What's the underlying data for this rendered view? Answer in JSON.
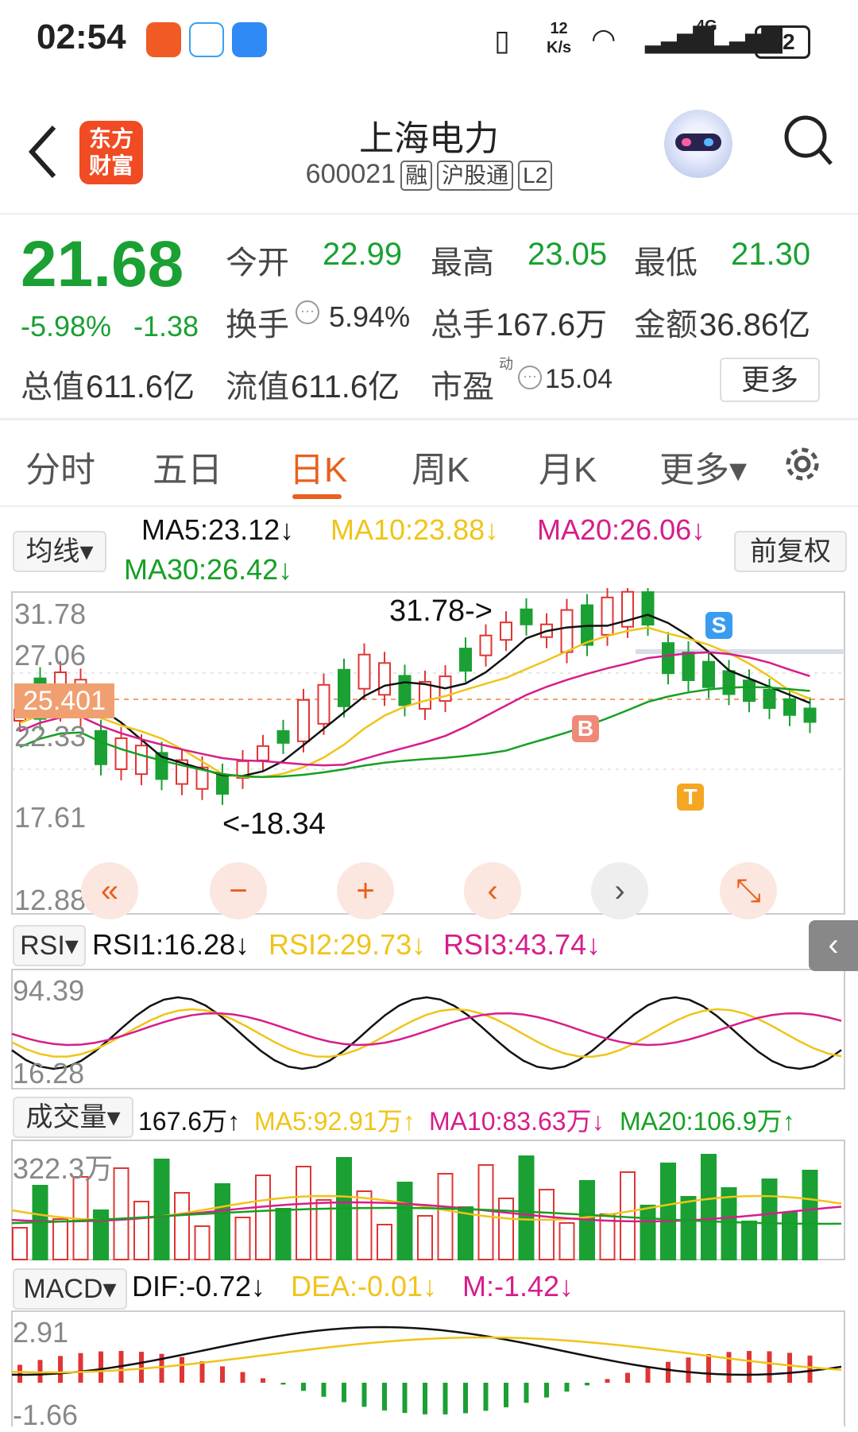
{
  "status_bar": {
    "time": "02:54",
    "speed_top": "12",
    "speed_unit": "K/s",
    "network": "4G",
    "battery": "32"
  },
  "header": {
    "back_icon": "chevron-left-icon",
    "brand_line1": "东方",
    "brand_line2": "财富",
    "title": "上海电力",
    "code": "600021",
    "tags": [
      "融",
      "沪股通",
      "L2"
    ]
  },
  "quote": {
    "price": "21.68",
    "change_pct": "-5.98%",
    "change": "-1.38",
    "open_label": "今开",
    "open": "22.99",
    "high_label": "最高",
    "high": "23.05",
    "low_label": "最低",
    "low": "21.30",
    "turnover_label": "换手",
    "turnover": "5.94%",
    "volume_label": "总手",
    "volume": "167.6万",
    "amount_label": "金额",
    "amount": "36.86亿",
    "mktcap_label": "总值",
    "mktcap": "611.6亿",
    "float_label": "流值",
    "float": "611.6亿",
    "pe_label": "市盈",
    "pe_sup": "动",
    "pe": "15.04",
    "more_button": "更多"
  },
  "tabs": {
    "items": [
      "分时",
      "五日",
      "日K",
      "周K",
      "月K",
      "更多▾"
    ],
    "active": 2
  },
  "kline": {
    "indicator_select": "均线▾",
    "ma5": "MA5:23.12↓",
    "ma10": "MA10:23.88↓",
    "ma20": "MA20:26.06↓",
    "ma30": "MA30:26.42↓",
    "adjust_button": "前复权",
    "y_labels": [
      "31.78",
      "27.06",
      "22.33",
      "17.61",
      "12.88"
    ],
    "current_tag": "25.401",
    "high_annotation": "31.78->",
    "low_annotation": "<-18.34",
    "marker_b": "B",
    "marker_s": "S",
    "marker_t": "T",
    "controls": [
      "«",
      "−",
      "+",
      "‹",
      "›",
      "⤡"
    ]
  },
  "rsi": {
    "select": "RSI▾",
    "rsi1": "RSI1:16.28↓",
    "rsi2": "RSI2:29.73↓",
    "rsi3": "RSI3:43.74↓",
    "y_top": "94.39",
    "y_bottom": "16.28"
  },
  "volume_panel": {
    "select": "成交量▾",
    "current": "167.6万↑",
    "ma5": "MA5:92.91万↑",
    "ma10": "MA10:83.63万↓",
    "ma20": "MA20:106.9万↑",
    "y_top": "322.3万"
  },
  "macd": {
    "select": "MACD▾",
    "dif": "DIF:-0.72↓",
    "dea": "DEA:-0.01↓",
    "m": "M:-1.42↓",
    "y_top": "2.91",
    "y_bottom": "-1.66"
  },
  "colors": {
    "up": "#e03535",
    "down": "#1aa033",
    "ma5": "#111111",
    "ma10": "#f0c419",
    "ma20": "#d61e8a",
    "ma30": "#16a023",
    "accent": "#e8601c"
  }
}
